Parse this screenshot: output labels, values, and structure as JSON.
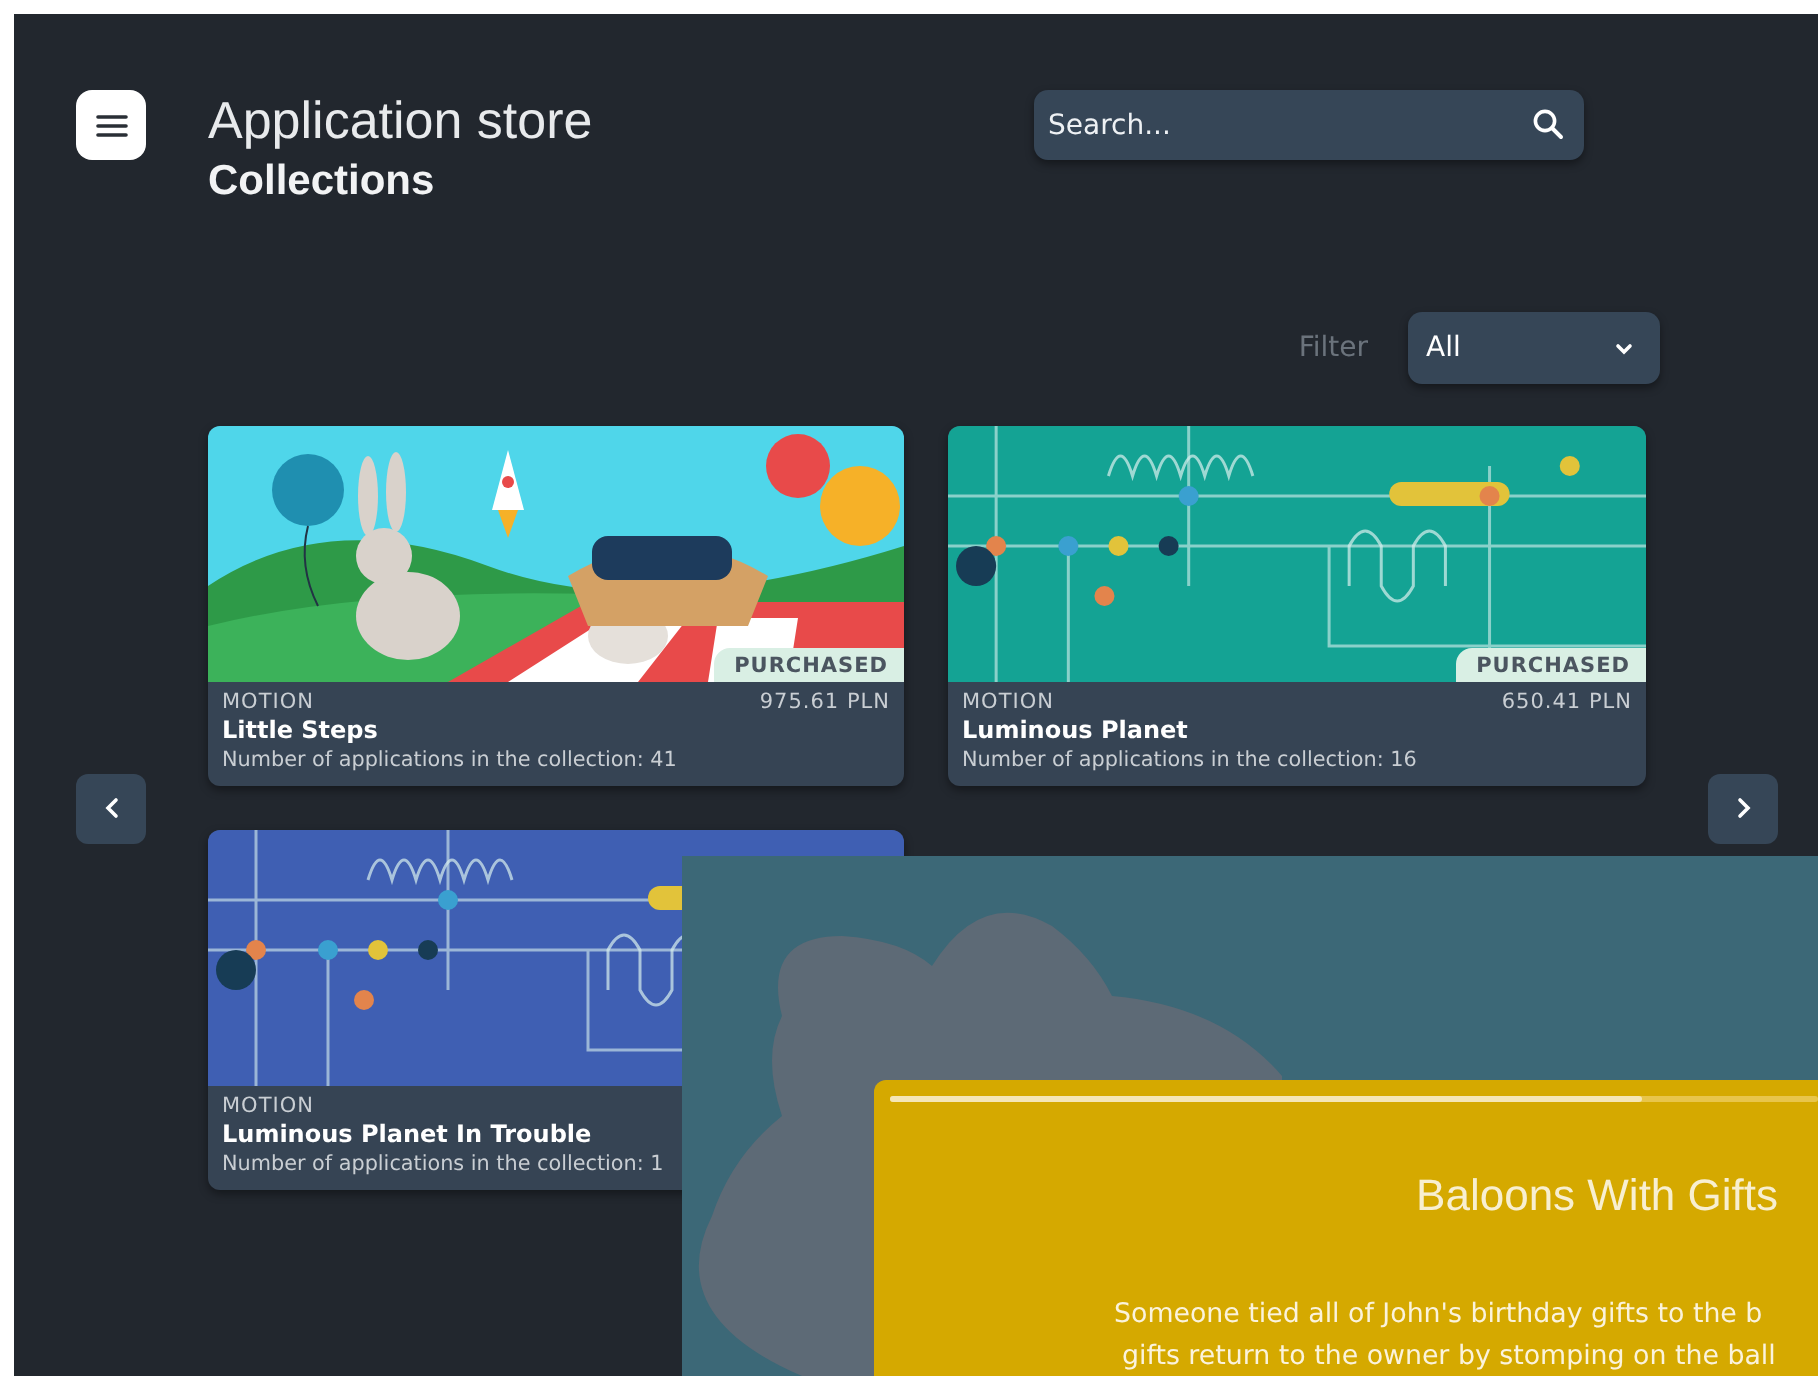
{
  "header": {
    "title": "Application store",
    "subtitle": "Collections"
  },
  "search": {
    "placeholder": "Search..."
  },
  "filter": {
    "label": "Filter",
    "value": "All"
  },
  "collections": [
    {
      "category": "MOTION",
      "title": "Little Steps",
      "price": "975.61 PLN",
      "count": "Number of applications in the collection: 41",
      "badge": "PURCHASED",
      "kind": "picnic"
    },
    {
      "category": "MOTION",
      "title": "Luminous Planet",
      "price": "650.41 PLN",
      "count": "Number of applications in the collection: 16",
      "badge": "PURCHASED",
      "kind": "teal"
    },
    {
      "category": "MOTION",
      "title": "Luminous Planet In Trouble",
      "count": "Number of applications in the collection: 1",
      "kind": "blue"
    }
  ],
  "preview": {
    "progress": {
      "level": 0.81
    },
    "title": "Baloons With Gifts",
    "description_lines": [
      "Someone tied all of John's birthday gifts to the b",
      "gifts return to the owner by stomping on the ball"
    ]
  }
}
